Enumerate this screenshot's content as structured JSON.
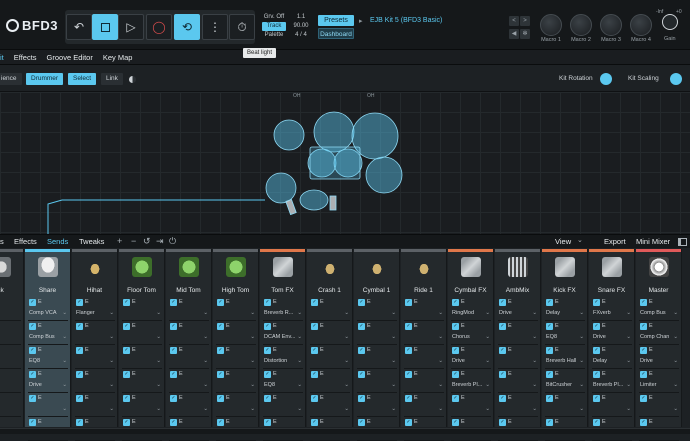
{
  "app": {
    "logo": "BFD3"
  },
  "transport": {
    "buttons": [
      "undo",
      "stop",
      "play",
      "record",
      "loop",
      "more",
      "metronome"
    ],
    "info_col1": [
      "Grv. Off",
      "Track",
      "Palette"
    ],
    "info_col2": [
      "1.1",
      "90.00",
      "4 / 4"
    ]
  },
  "presets": {
    "presets_label": "Presets",
    "dashboard_label": "Dashboard",
    "kit_name": "EJB Kit 5 (BFD3 Basic)",
    "kit_arrow": "▸"
  },
  "tooltip": "Beat light",
  "macros": [
    {
      "label": "Macro 1"
    },
    {
      "label": "Macro 2"
    },
    {
      "label": "Macro 3"
    },
    {
      "label": "Macro 4"
    }
  ],
  "gain": {
    "label": "Gain",
    "min": "-Inf",
    "max": "+0"
  },
  "tabs": [
    "it",
    "Effects",
    "Groove Editor",
    "Key Map"
  ],
  "kitbar": {
    "buttons": [
      {
        "label": "ience",
        "on": false
      },
      {
        "label": "Drummer",
        "on": true
      },
      {
        "label": "Select",
        "on": true
      },
      {
        "label": "Link",
        "on": false
      }
    ],
    "kit_rotation": "Kit Rotation",
    "kit_scaling": "Kit Scaling"
  },
  "stage": {
    "oh_labels": [
      "OH",
      "OH"
    ]
  },
  "mixer_tabs": {
    "left": [
      "s",
      "Effects",
      "Sends",
      "Tweaks"
    ],
    "view": "View",
    "export": "Export",
    "mini_mixer": "Mini Mixer"
  },
  "channels": [
    {
      "name": "ck",
      "color": "#5c6166",
      "icon": "drum",
      "slots": [
        [
          "",
          "",
          ""
        ],
        [
          "",
          "",
          ""
        ],
        [
          "",
          "",
          ""
        ],
        [
          "",
          "",
          ""
        ],
        [
          "",
          "",
          ""
        ]
      ]
    },
    {
      "name": "Share",
      "color": "#5bc8ef",
      "icon": "snare",
      "sel": true,
      "slots": [
        [
          "E",
          "Comp VCA",
          ""
        ],
        [
          "E",
          "Comp Bus",
          ""
        ],
        [
          "E",
          "EQ8",
          ""
        ],
        [
          "E",
          "Drive",
          ""
        ],
        [
          "E",
          "",
          ""
        ],
        [
          "E",
          "",
          ""
        ]
      ]
    },
    {
      "name": "Hihat",
      "color": "#5c6166",
      "icon": "hat",
      "slots": [
        [
          "E",
          "Flanger",
          ""
        ],
        [
          "E",
          "",
          ""
        ],
        [
          "E",
          "",
          ""
        ],
        [
          "E",
          "",
          ""
        ],
        [
          "E",
          "",
          ""
        ],
        [
          "E",
          "",
          ""
        ]
      ]
    },
    {
      "name": "Floor Tom",
      "color": "#5c6166",
      "icon": "tom",
      "slots": [
        [
          "E",
          "",
          ""
        ],
        [
          "E",
          "",
          ""
        ],
        [
          "E",
          "",
          ""
        ],
        [
          "E",
          "",
          ""
        ],
        [
          "E",
          "",
          ""
        ],
        [
          "E",
          "",
          ""
        ]
      ]
    },
    {
      "name": "Mid Tom",
      "color": "#5c6166",
      "icon": "tom",
      "slots": [
        [
          "E",
          "",
          ""
        ],
        [
          "E",
          "",
          ""
        ],
        [
          "E",
          "",
          ""
        ],
        [
          "E",
          "",
          ""
        ],
        [
          "E",
          "",
          ""
        ],
        [
          "E",
          "",
          ""
        ]
      ]
    },
    {
      "name": "High Tom",
      "color": "#5c6166",
      "icon": "tom",
      "slots": [
        [
          "E",
          "",
          ""
        ],
        [
          "E",
          "",
          ""
        ],
        [
          "E",
          "",
          ""
        ],
        [
          "E",
          "",
          ""
        ],
        [
          "E",
          "",
          ""
        ],
        [
          "E",
          "",
          ""
        ]
      ]
    },
    {
      "name": "Tom FX",
      "color": "#e0774a",
      "icon": "fx",
      "slots": [
        [
          "E",
          "Breverb R...",
          ""
        ],
        [
          "E",
          "DCAM Env...",
          ""
        ],
        [
          "E",
          "Distortion",
          ""
        ],
        [
          "E",
          "EQ8",
          ""
        ],
        [
          "E",
          "",
          ""
        ],
        [
          "E",
          "",
          ""
        ]
      ]
    },
    {
      "name": "Crash 1",
      "color": "#5c6166",
      "icon": "cym",
      "slots": [
        [
          "E",
          "",
          ""
        ],
        [
          "E",
          "",
          ""
        ],
        [
          "E",
          "",
          ""
        ],
        [
          "E",
          "",
          ""
        ],
        [
          "E",
          "",
          ""
        ],
        [
          "E",
          "",
          ""
        ]
      ]
    },
    {
      "name": "Cymbal 1",
      "color": "#5c6166",
      "icon": "cym",
      "slots": [
        [
          "E",
          "",
          ""
        ],
        [
          "E",
          "",
          ""
        ],
        [
          "E",
          "",
          ""
        ],
        [
          "E",
          "",
          ""
        ],
        [
          "E",
          "",
          ""
        ],
        [
          "E",
          "",
          ""
        ]
      ]
    },
    {
      "name": "Ride 1",
      "color": "#5c6166",
      "icon": "cym",
      "slots": [
        [
          "E",
          "",
          ""
        ],
        [
          "E",
          "",
          ""
        ],
        [
          "E",
          "",
          ""
        ],
        [
          "E",
          "",
          ""
        ],
        [
          "E",
          "",
          ""
        ],
        [
          "E",
          "",
          ""
        ]
      ]
    },
    {
      "name": "Cymbal FX",
      "color": "#e0774a",
      "icon": "fx",
      "slots": [
        [
          "E",
          "RingMod",
          ""
        ],
        [
          "E",
          "Chorus",
          ""
        ],
        [
          "E",
          "Drive",
          ""
        ],
        [
          "E",
          "Breverb Pl...",
          ""
        ],
        [
          "E",
          "",
          ""
        ],
        [
          "E",
          "",
          ""
        ]
      ]
    },
    {
      "name": "AmbMix",
      "color": "#5c6166",
      "icon": "amb",
      "slots": [
        [
          "E",
          "Drive",
          ""
        ],
        [
          "E",
          "",
          ""
        ],
        [
          "E",
          "",
          ""
        ],
        [
          "E",
          "",
          ""
        ],
        [
          "E",
          "",
          ""
        ],
        [
          "E",
          "",
          ""
        ]
      ]
    },
    {
      "name": "Kick FX",
      "color": "#e0774a",
      "icon": "fx",
      "slots": [
        [
          "E",
          "Delay",
          ""
        ],
        [
          "E",
          "EQ8",
          ""
        ],
        [
          "E",
          "Breverb Hall",
          ""
        ],
        [
          "E",
          "BitCrusher",
          ""
        ],
        [
          "E",
          "",
          ""
        ],
        [
          "E",
          "",
          ""
        ]
      ]
    },
    {
      "name": "Snare FX",
      "color": "#e0774a",
      "icon": "fx",
      "slots": [
        [
          "E",
          "FXverb",
          ""
        ],
        [
          "E",
          "Drive",
          ""
        ],
        [
          "E",
          "Delay",
          ""
        ],
        [
          "E",
          "Breverb Pl...",
          ""
        ],
        [
          "E",
          "",
          ""
        ],
        [
          "E",
          "",
          ""
        ]
      ]
    },
    {
      "name": "Master",
      "color": "#e05a5a",
      "icon": "master",
      "slots": [
        [
          "E",
          "Comp Bus",
          ""
        ],
        [
          "E",
          "Comp Chan",
          ""
        ],
        [
          "E",
          "Drive",
          ""
        ],
        [
          "E",
          "Limiter",
          ""
        ],
        [
          "E",
          "",
          ""
        ],
        [
          "E",
          "",
          ""
        ]
      ]
    }
  ]
}
